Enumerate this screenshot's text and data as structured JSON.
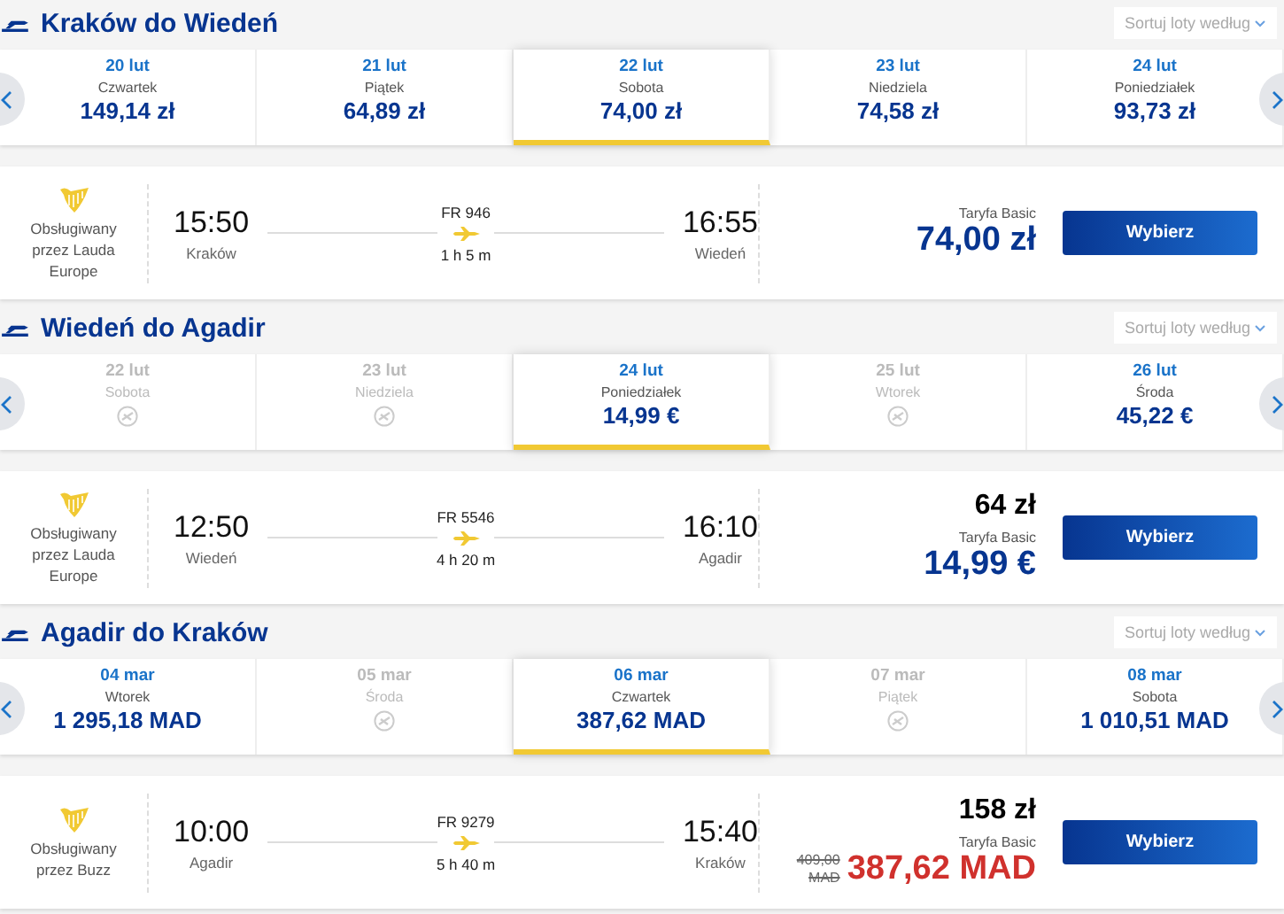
{
  "legs": [
    {
      "title": "Kraków do Wiedeń",
      "sort": "Sortuj loty według",
      "dates": [
        {
          "date": "20 lut",
          "day": "Czwartek",
          "price": "149,14 zł",
          "available": true,
          "selected": false
        },
        {
          "date": "21 lut",
          "day": "Piątek",
          "price": "64,89 zł",
          "available": true,
          "selected": false
        },
        {
          "date": "22 lut",
          "day": "Sobota",
          "price": "74,00 zł",
          "available": true,
          "selected": true
        },
        {
          "date": "23 lut",
          "day": "Niedziela",
          "price": "74,58 zł",
          "available": true,
          "selected": false
        },
        {
          "date": "24 lut",
          "day": "Poniedziałek",
          "price": "93,73 zł",
          "available": true,
          "selected": false
        }
      ],
      "flight": {
        "operator": "Obsługiwany przez Lauda Europe",
        "depart_time": "15:50",
        "depart_city": "Kraków",
        "number": "FR 946",
        "duration": "1 h 5 m",
        "arrive_time": "16:55",
        "arrive_city": "Wiedeń",
        "fare": "Taryfa Basic",
        "price": "74,00 zł",
        "promo": false,
        "button": "Wybierz"
      }
    },
    {
      "title": "Wiedeń do Agadir",
      "sort": "Sortuj loty według",
      "dates": [
        {
          "date": "22 lut",
          "day": "Sobota",
          "available": false,
          "selected": false
        },
        {
          "date": "23 lut",
          "day": "Niedziela",
          "available": false,
          "selected": false
        },
        {
          "date": "24 lut",
          "day": "Poniedziałek",
          "price": "14,99 €",
          "available": true,
          "selected": true
        },
        {
          "date": "25 lut",
          "day": "Wtorek",
          "available": false,
          "selected": false
        },
        {
          "date": "26 lut",
          "day": "Środa",
          "price": "45,22 €",
          "available": true,
          "selected": false
        }
      ],
      "flight": {
        "operator": "Obsługiwany przez Lauda Europe",
        "depart_time": "12:50",
        "depart_city": "Wiedeń",
        "number": "FR 5546",
        "duration": "4 h 20 m",
        "arrive_time": "16:10",
        "arrive_city": "Agadir",
        "converted": "64 zł",
        "fare": "Taryfa Basic",
        "price": "14,99 €",
        "promo": false,
        "button": "Wybierz"
      }
    },
    {
      "title": "Agadir do Kraków",
      "sort": "Sortuj loty według",
      "dates": [
        {
          "date": "04 mar",
          "day": "Wtorek",
          "price": "1 295,18 MAD",
          "available": true,
          "selected": false
        },
        {
          "date": "05 mar",
          "day": "Środa",
          "available": false,
          "selected": false
        },
        {
          "date": "06 mar",
          "day": "Czwartek",
          "price": "387,62 MAD",
          "available": true,
          "selected": true
        },
        {
          "date": "07 mar",
          "day": "Piątek",
          "available": false,
          "selected": false
        },
        {
          "date": "08 mar",
          "day": "Sobota",
          "price": "1 010,51 MAD",
          "available": true,
          "selected": false
        }
      ],
      "flight": {
        "operator": "Obsługiwany przez Buzz",
        "depart_time": "10:00",
        "depart_city": "Agadir",
        "number": "FR 9279",
        "duration": "5 h 40 m",
        "arrive_time": "15:40",
        "arrive_city": "Kraków",
        "converted": "158 zł",
        "fare": "Taryfa Basic",
        "old_price": "409,00 MAD",
        "price": "387,62 MAD",
        "promo": true,
        "button": "Wybierz"
      }
    }
  ]
}
